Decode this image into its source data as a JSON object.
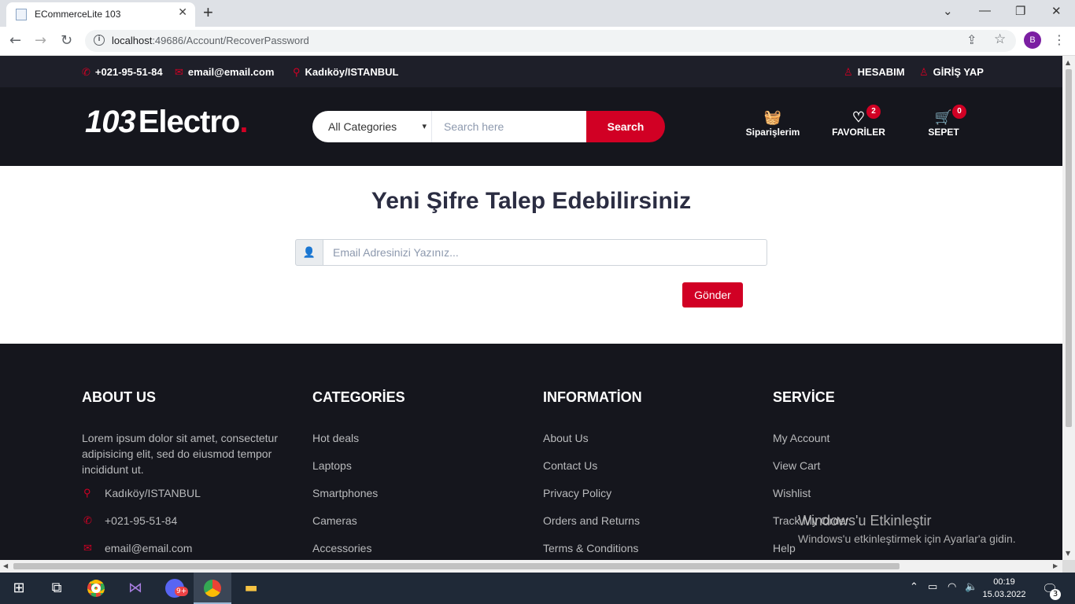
{
  "browser": {
    "tab_title": "ECommerceLite 103",
    "url_host": "localhost",
    "url_path": ":49686/Account/RecoverPassword",
    "profile_initial": "B",
    "new_tab": "+",
    "tab_close": "✕",
    "win_min": "—",
    "win_max": "❐",
    "win_close": "✕",
    "back": "←",
    "forward": "→",
    "reload": "↻",
    "share": "⇪",
    "star": "☆",
    "menu": "⋮",
    "tab_list": "⌄"
  },
  "topbar": {
    "phone": "+021-95-51-84",
    "email": "email@email.com",
    "location": "Kadıköy/ISTANBUL",
    "account": "HESABIM",
    "login": "GİRİŞ YAP"
  },
  "header": {
    "logo_number": "103",
    "logo_text": "Electro",
    "logo_dot": ".",
    "category_selected": "All Categories",
    "search_placeholder": "Search here",
    "search_button": "Search",
    "orders_label": "Siparişlerim",
    "favorites_label": "FAVORİLER",
    "favorites_count": "2",
    "cart_label": "SEPET",
    "cart_count": "0"
  },
  "recover": {
    "title": "Yeni Şifre Talep Edebilirsiniz",
    "email_placeholder": "Email Adresinizi Yazınız...",
    "submit": "Gönder"
  },
  "footer": {
    "about": {
      "heading": "ABOUT US",
      "text": "Lorem ipsum dolor sit amet, consectetur adipisicing elit, sed do eiusmod tempor incididunt ut.",
      "location": "Kadıköy/ISTANBUL",
      "phone": "+021-95-51-84",
      "email": "email@email.com"
    },
    "categories": {
      "heading": "CATEGORİES",
      "items": [
        "Hot deals",
        "Laptops",
        "Smartphones",
        "Cameras",
        "Accessories"
      ]
    },
    "information": {
      "heading": "INFORMATİON",
      "items": [
        "About Us",
        "Contact Us",
        "Privacy Policy",
        "Orders and Returns",
        "Terms & Conditions"
      ]
    },
    "service": {
      "heading": "SERVİCE",
      "items": [
        "My Account",
        "View Cart",
        "Wishlist",
        "Track My Order",
        "Help"
      ]
    }
  },
  "watermark": {
    "line1": "Windows'u Etkinleştir",
    "line2": "Windows'u etkinleştirmek için Ayarlar'a gidin."
  },
  "taskbar": {
    "time": "00:19",
    "date": "15.03.2022",
    "notification_count": "3",
    "discord_badge": "9+"
  },
  "icons": {
    "phone": "phone-icon",
    "email": "envelope-icon",
    "location": "map-marker-icon",
    "user": "user-icon",
    "basket": "basket-icon",
    "heart": "heart-icon",
    "cart": "shopping-cart-icon"
  },
  "colors": {
    "accent": "#d10024",
    "dark": "#15161d",
    "topstrip": "#1e1f29",
    "heading": "#2b2d42"
  }
}
